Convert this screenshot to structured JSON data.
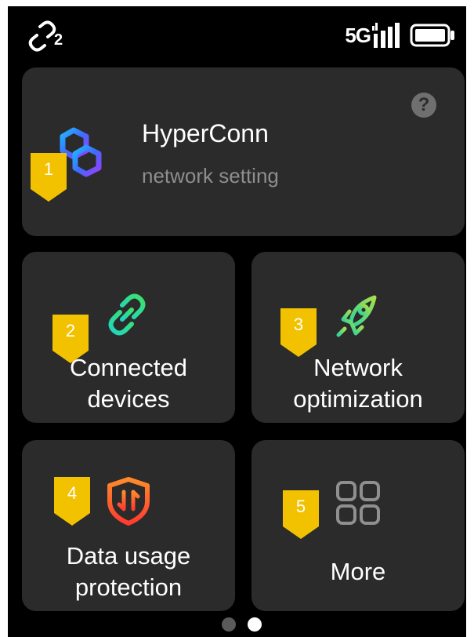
{
  "status_bar": {
    "link_count": "2",
    "network_type": "5G",
    "icons": [
      "link-icon",
      "signal-icon",
      "battery-icon"
    ]
  },
  "hyperconn": {
    "title": "HyperConn",
    "subtitle": "network setting",
    "help_symbol": "?",
    "icon": "hyperconn-logo-icon"
  },
  "tiles": [
    {
      "line1": "Connected",
      "line2": "devices",
      "icon": "link-chain-icon"
    },
    {
      "line1": "Network",
      "line2": "optimization",
      "icon": "rocket-icon"
    },
    {
      "line1": "Data usage",
      "line2": "protection",
      "icon": "shield-icon"
    },
    {
      "line1": "More",
      "icon": "grid-icon"
    }
  ],
  "markers": [
    "1",
    "2",
    "3",
    "4",
    "5"
  ],
  "pager": {
    "total": 2,
    "current": 2
  },
  "colors": {
    "background": "#000000",
    "card": "#2b2b2b",
    "marker": "#f2c200",
    "subtitle": "#8e8e8e"
  }
}
